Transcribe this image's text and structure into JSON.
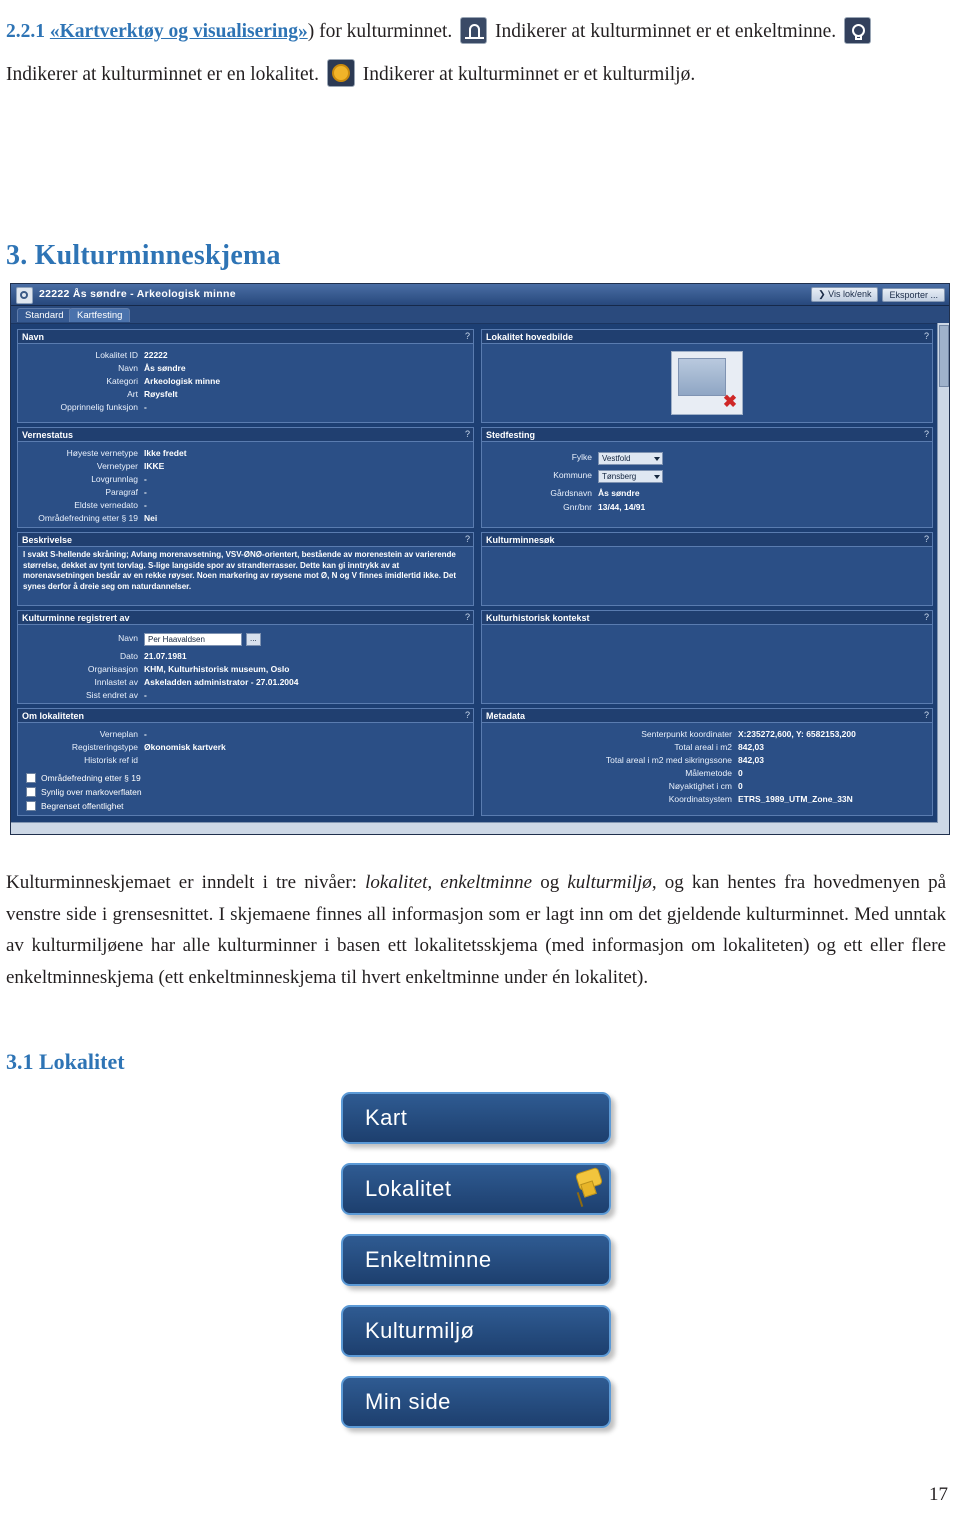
{
  "intro": {
    "section_number": "2.2.1",
    "link_text": "«Kartverktøy og visualisering»",
    "after_link": ") for kulturminnet.",
    "legend_enkeltminne": "Indikerer at kulturminnet er et enkeltminne.",
    "legend_lokalitet": "Indikerer at kulturminnet er en lokalitet.",
    "legend_kulturmiljo": "Indikerer at kulturminnet er et kulturmiljø.",
    "icons": {
      "enkeltminne": "enkeltminne-icon",
      "lokalitet": "lokalitet-icon",
      "kulturmiljo": "kulturmiljo-icon"
    }
  },
  "heading_3": "3. Kulturminneskjema",
  "heading_3_1": "3.1 Lokalitet",
  "body_paragraph": {
    "part1": "Kulturminneskjemaet er inndelt i tre nivåer: ",
    "em1": "lokalitet, enkeltminne",
    "part2": " og ",
    "em2": "kulturmiljø",
    "part3": ", og  kan hentes fra hovedmenyen på venstre side i grensesnittet. I skjemaene finnes all informasjon som er lagt inn om det gjeldende kulturminnet.  Med unntak av kulturmiljøene har alle kulturminner i basen ett lokalitetsskjema (med informasjon om lokaliteten) og ett  eller flere enkeltminneskjema (ett enkeltminneskjema til hvert enkeltminne under én lokalitet)."
  },
  "app": {
    "title": "22222   Ås søndre   -   Arkeologisk minne",
    "toolbar_buttons": [
      "Vis lok/enk",
      "Eksporter ..."
    ],
    "tabs": [
      "Standard",
      "Kartfesting"
    ],
    "panels": {
      "navn": {
        "title": "Navn",
        "help": "?",
        "fields": [
          {
            "label": "Lokalitet ID",
            "value": "22222"
          },
          {
            "label": "Navn",
            "value": "Ås søndre"
          },
          {
            "label": "Kategori",
            "value": "Arkeologisk minne"
          },
          {
            "label": "Art",
            "value": "Røysfelt"
          },
          {
            "label": "Opprinnelig funksjon",
            "value": "-"
          }
        ]
      },
      "hovedbilde": {
        "title": "Lokalitet hovedbilde",
        "help": "?"
      },
      "vernestatus": {
        "title": "Vernestatus",
        "help": "?",
        "fields": [
          {
            "label": "Høyeste vernetype",
            "value": "Ikke fredet"
          },
          {
            "label": "Vernetyper",
            "value": "IKKE"
          },
          {
            "label": "Lovgrunnlag",
            "value": "-"
          },
          {
            "label": "Paragraf",
            "value": "-"
          },
          {
            "label": "Eldste vernedato",
            "value": "-"
          },
          {
            "label": "Områdefredning etter § 19",
            "value": "Nei"
          }
        ]
      },
      "stedfesting": {
        "title": "Stedfesting",
        "help": "?",
        "fields": [
          {
            "label": "Fylke",
            "value": "Vestfold",
            "type": "combo"
          },
          {
            "label": "Kommune",
            "value": "Tønsberg",
            "type": "combo"
          },
          {
            "label": "Gårdsnavn",
            "value": "Ås søndre",
            "type": "text"
          },
          {
            "label": "Gnr/bnr",
            "value": "13/44, 14/91",
            "type": "text"
          }
        ]
      },
      "beskrivelse": {
        "title": "Beskrivelse",
        "help": "?",
        "text": "I svakt S-hellende skråning; Avlang morenavsetning, VSV-ØNØ-orientert, bestående av morenestein av varierende størrelse, dekket av tynt torvlag. S-lige langside spor av strandterrasser. Dette kan gi inntrykk av at morenavsetningen består av en rekke røyser. Noen markering av røysene mot Ø, N og V finnes imidlertid ikke. Det synes derfor å dreie seg om naturdannelser."
      },
      "kulturminnesok": {
        "title": "Kulturminnesøk",
        "help": "?"
      },
      "registrert_av": {
        "title": "Kulturminne registrert av",
        "help": "?",
        "fields": [
          {
            "label": "Navn",
            "value": "Per Haavaldsen",
            "type": "text",
            "button": "..."
          },
          {
            "label": "Dato",
            "value": "21.07.1981"
          },
          {
            "label": "Organisasjon",
            "value": "KHM, Kulturhistorisk museum, Oslo"
          },
          {
            "label": "Innlastet av",
            "value": "Askeladden administrator  -  27.01.2004"
          },
          {
            "label": "Sist endret av",
            "value": "-"
          }
        ]
      },
      "kontekst": {
        "title": "Kulturhistorisk kontekst",
        "help": "?"
      },
      "om_lokaliteten": {
        "title": "Om lokaliteten",
        "help": "?",
        "fields": [
          {
            "label": "Verneplan",
            "value": "-"
          },
          {
            "label": "Registreringstype",
            "value": "Økonomisk kartverk"
          },
          {
            "label": "Historisk ref id",
            "value": ""
          }
        ],
        "checkboxes": [
          "Områdefredning etter § 19",
          "Synlig over markoverflaten",
          "Begrenset offentlighet"
        ]
      },
      "metadata": {
        "title": "Metadata",
        "help": "?",
        "fields": [
          {
            "label": "Senterpunkt koordinater",
            "value": "X:235272,600, Y: 6582153,200"
          },
          {
            "label": "Total areal i m2",
            "value": "842,03"
          },
          {
            "label": "Total areal i m2 med sikringssone",
            "value": "842,03"
          },
          {
            "label": "Målemetode",
            "value": "0"
          },
          {
            "label": "Nøyaktighet i cm",
            "value": "0"
          },
          {
            "label": "Koordinatsystem",
            "value": "ETRS_1989_UTM_Zone_33N"
          }
        ]
      }
    }
  },
  "menu": {
    "buttons": [
      "Kart",
      "Lokalitet",
      "Enkeltminne",
      "Kulturmiljø",
      "Min side"
    ],
    "pin_icon": "pushpin-icon"
  },
  "page_number": "17"
}
